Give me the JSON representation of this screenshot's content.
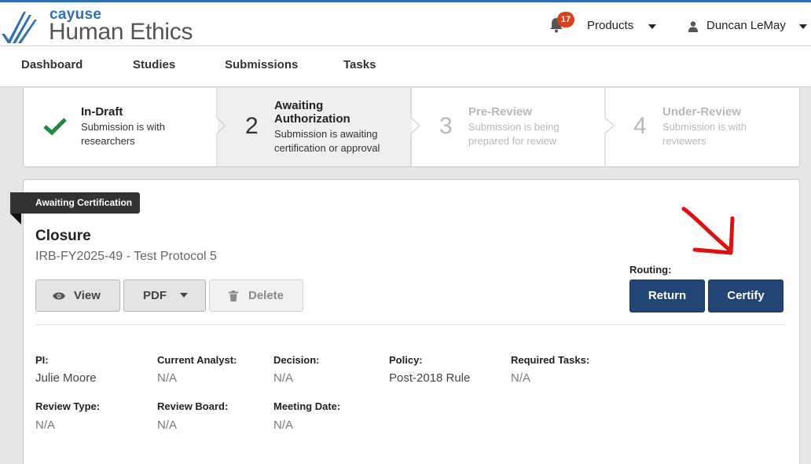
{
  "brand": {
    "small": "cayuse",
    "big": "Human Ethics"
  },
  "header": {
    "notification_count": "17",
    "products_label": "Products",
    "user_name": "Duncan LeMay"
  },
  "nav": {
    "items": [
      "Dashboard",
      "Studies",
      "Submissions",
      "Tasks"
    ]
  },
  "stepper": {
    "steps": [
      {
        "number": "",
        "title": "In-Draft",
        "desc1": "Submission is with",
        "desc2": "researchers",
        "state": "complete"
      },
      {
        "number": "2",
        "title1": "Awaiting",
        "title2": "Authorization",
        "desc1": "Submission is awaiting",
        "desc2": "certification or approval",
        "state": "current"
      },
      {
        "number": "3",
        "title": "Pre-Review",
        "desc1": "Submission is being",
        "desc2": "prepared for review",
        "state": "upcoming"
      },
      {
        "number": "4",
        "title": "Under-Review",
        "desc1": "Submission is with",
        "desc2": "reviewers",
        "state": "upcoming"
      }
    ]
  },
  "submission": {
    "status_badge": "Awaiting Certification",
    "title": "Closure",
    "subtitle": "IRB-FY2025-49 - Test Protocol 5"
  },
  "actions": {
    "view_label": "View",
    "pdf_label": "PDF",
    "delete_label": "Delete",
    "routing_label": "Routing:",
    "return_label": "Return",
    "certify_label": "Certify"
  },
  "details": {
    "pi": {
      "label": "PI:",
      "value": "Julie Moore"
    },
    "analyst": {
      "label": "Current Analyst:",
      "value": "N/A"
    },
    "decision": {
      "label": "Decision:",
      "value": "N/A"
    },
    "policy": {
      "label": "Policy:",
      "value": "Post-2018 Rule"
    },
    "tasks": {
      "label": "Required Tasks:",
      "value": "N/A"
    },
    "review_type": {
      "label": "Review Type:",
      "value": "N/A"
    },
    "review_board": {
      "label": "Review Board:",
      "value": "N/A"
    },
    "meeting_date": {
      "label": "Meeting Date:",
      "value": "N/A"
    }
  },
  "icons": [
    "cayuse-logo-icon",
    "bell-icon",
    "chevron-down-icon",
    "user-icon",
    "checkmark-icon",
    "chevron-right-icon",
    "eye-icon",
    "trash-icon",
    "annotation-arrow-icon"
  ],
  "colors": {
    "brand_blue": "#2e6fb5",
    "primary_button": "#234575",
    "badge_red": "#d9411e",
    "success_green": "#1f8a3b",
    "annotation_red": "#e01010"
  }
}
